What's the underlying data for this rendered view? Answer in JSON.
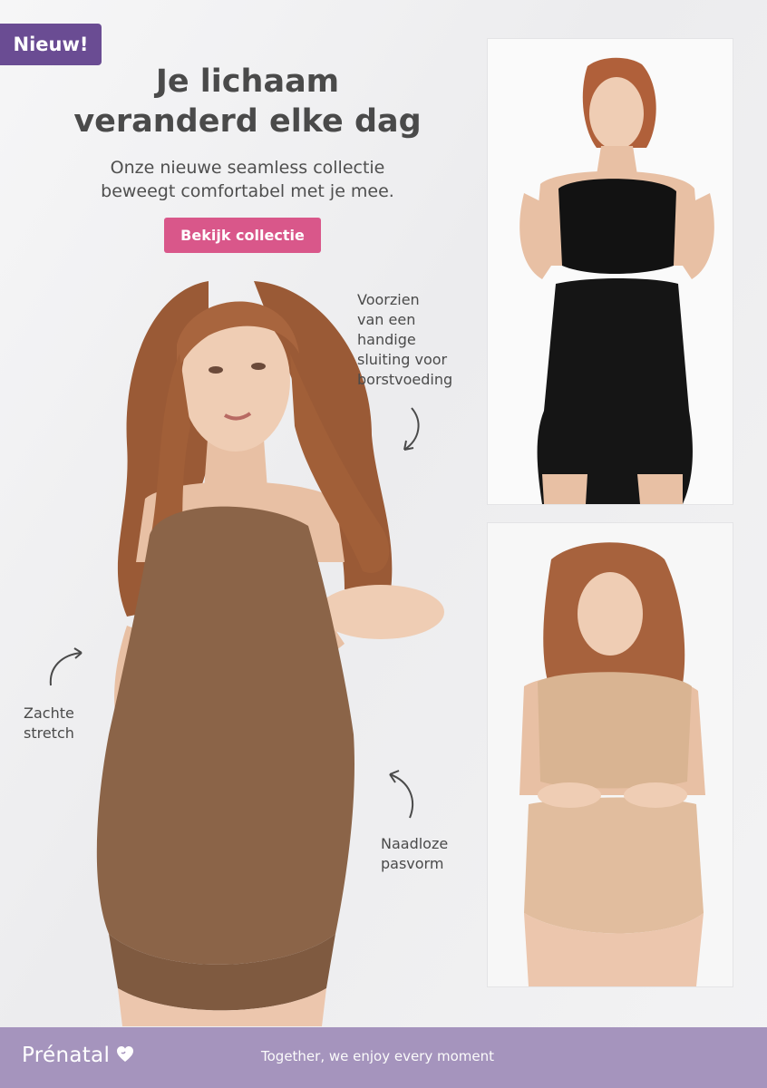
{
  "badge": "Nieuw!",
  "headline": {
    "line1": "Je lichaam",
    "line2": "veranderd elke dag"
  },
  "subline": {
    "line1": "Onze nieuwe seamless collectie",
    "line2": "beweegt comfortabel met je mee."
  },
  "cta_label": "Bekijk collectie",
  "annotations": {
    "nursing": "Voorzien\nvan een\nhandige\nsluiting voor\nborstvoeding",
    "stretch": "Zachte\nstretch",
    "seamless": "Naadloze\npasvorm"
  },
  "footer": {
    "brand": "Prénatal",
    "tagline": "Together, we enjoy every moment"
  },
  "colors": {
    "badge_bg": "#6a4c93",
    "cta_bg": "#d9578a",
    "footer_bg": "#a594bd",
    "headline": "#4a4a4a"
  },
  "icons": [
    "curved-arrow-down-icon",
    "curved-arrow-up-right-icon",
    "curved-arrow-up-left-icon",
    "heart-icon"
  ]
}
